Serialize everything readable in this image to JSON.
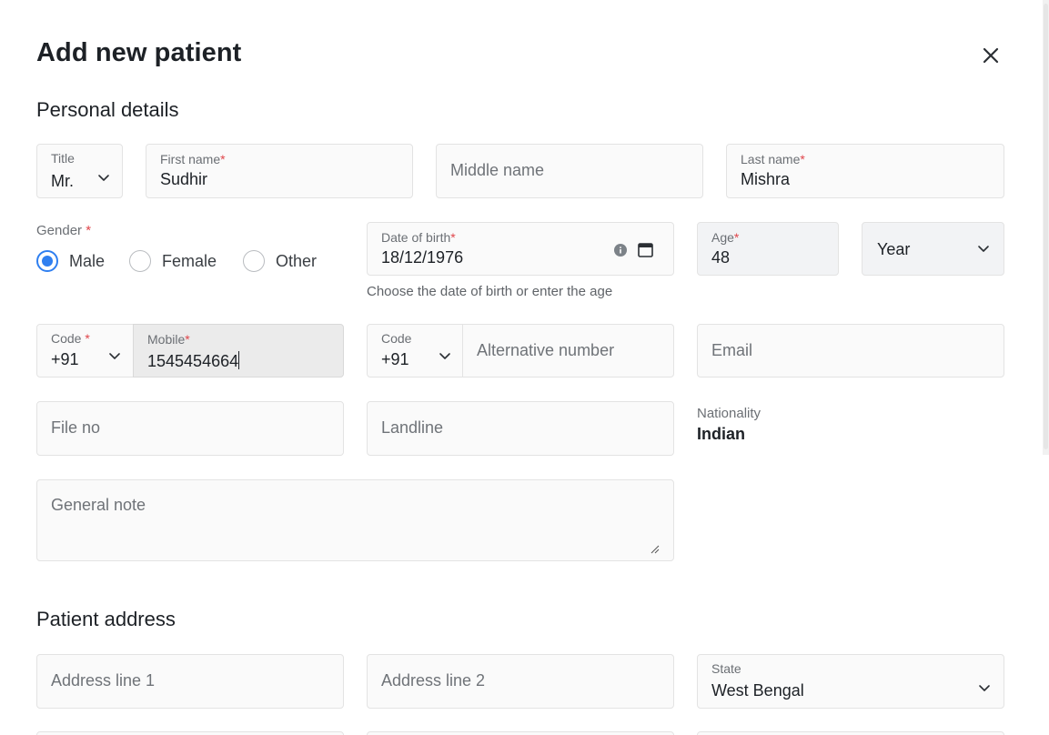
{
  "modal": {
    "title": "Add new patient"
  },
  "personal": {
    "section_title": "Personal details",
    "title_field": {
      "label": "Title",
      "value": "Mr."
    },
    "first_name": {
      "label": "First name",
      "value": "Sudhir"
    },
    "middle_name": {
      "placeholder": "Middle name"
    },
    "last_name": {
      "label": "Last name",
      "value": "Mishra"
    },
    "gender": {
      "label": "Gender",
      "options": [
        "Male",
        "Female",
        "Other"
      ],
      "selected": "Male"
    },
    "dob": {
      "label": "Date of birth",
      "value": "18/12/1976",
      "helper": "Choose the date of birth or enter the age"
    },
    "age": {
      "label": "Age",
      "value": "48"
    },
    "age_unit": {
      "value": "Year"
    },
    "mobile_code": {
      "label": "Code",
      "value": "+91"
    },
    "mobile": {
      "label": "Mobile",
      "value": "1545454664"
    },
    "alt_code": {
      "label": "Code",
      "value": "+91"
    },
    "alt_number": {
      "placeholder": "Alternative number"
    },
    "email": {
      "placeholder": "Email"
    },
    "file_no": {
      "placeholder": "File no"
    },
    "landline": {
      "placeholder": "Landline"
    },
    "nationality": {
      "label": "Nationality",
      "value": "Indian"
    },
    "general_note": {
      "placeholder": "General note"
    },
    "required_mark": "*"
  },
  "address": {
    "section_title": "Patient address",
    "line1": {
      "placeholder": "Address line 1"
    },
    "line2": {
      "placeholder": "Address line 2"
    },
    "state": {
      "label": "State",
      "value": "West Bengal"
    }
  },
  "icons": {
    "close": "close-icon",
    "chevron": "chevron-down-icon",
    "info": "info-icon",
    "calendar": "calendar-icon",
    "resize": "resize-handle-icon"
  },
  "colors": {
    "accent": "#2f7ff0",
    "required": "#e0464b"
  }
}
